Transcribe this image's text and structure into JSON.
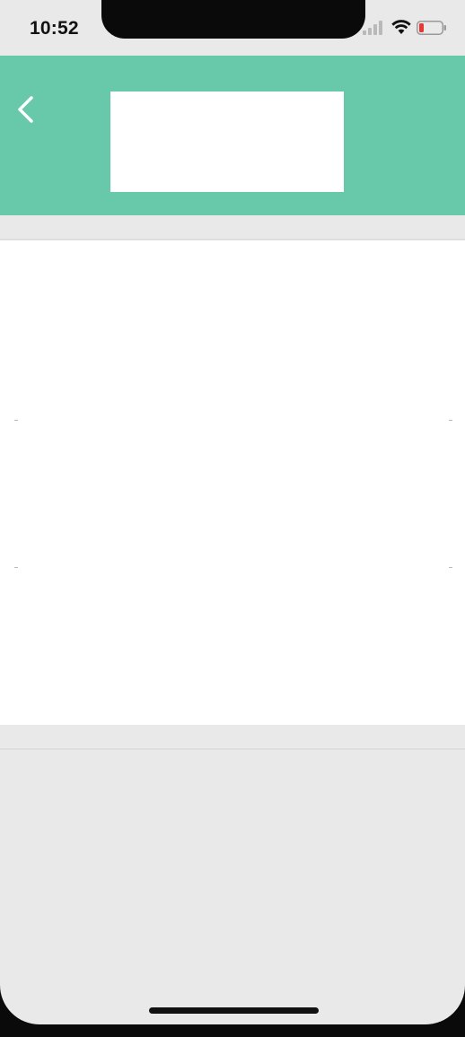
{
  "status_bar": {
    "time": "10:52",
    "icons": [
      "signal-icon",
      "wifi-icon",
      "battery-low-icon"
    ],
    "battery_color": "#e53935"
  },
  "header": {
    "background_color": "#68c9aa",
    "back_icon": "chevron-left-icon",
    "title": ""
  },
  "content": {
    "background_color": "#ffffff"
  },
  "page": {
    "background_color": "#e9e9e9"
  }
}
